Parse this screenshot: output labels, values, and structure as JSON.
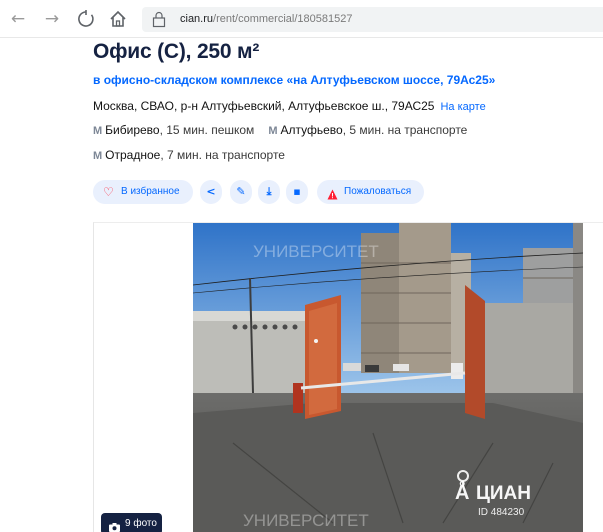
{
  "browser": {
    "url_host": "cian.ru",
    "url_path": "/rent/commercial/180581527"
  },
  "listing": {
    "title": "Офис (С), 250 м²",
    "complex_link": "в офисно-складском комплексе «на Алтуфьевском шоссе, 79Ас25»",
    "address": "Москва, СВАО, р-н Алтуфьевский, Алтуфьевское ш., 79АС25",
    "map_link": "На карте",
    "metro": [
      {
        "name": "Бибирево",
        "time": ", 15 мин. пешком"
      },
      {
        "name": "Алтуфьево",
        "time": ", 5 мин. на транспорте"
      },
      {
        "name": "Отрадное",
        "time": ", 7 мин. на транспорте"
      }
    ]
  },
  "actions": {
    "favorite": "В избранное",
    "complain": "Пожаловаться"
  },
  "gallery": {
    "photo_count": "9 фото",
    "watermark_top": "УНИВЕРСИТЕТ",
    "watermark_bottom": "УНИВЕРСИТЕТ",
    "logo_text": "ЦИАН",
    "photo_id": "ID 484230"
  },
  "colors": {
    "accent": "#0468ff",
    "title": "#152242",
    "button_bg": "#e9f0fd",
    "favorite_icon": "#ff1f34"
  }
}
